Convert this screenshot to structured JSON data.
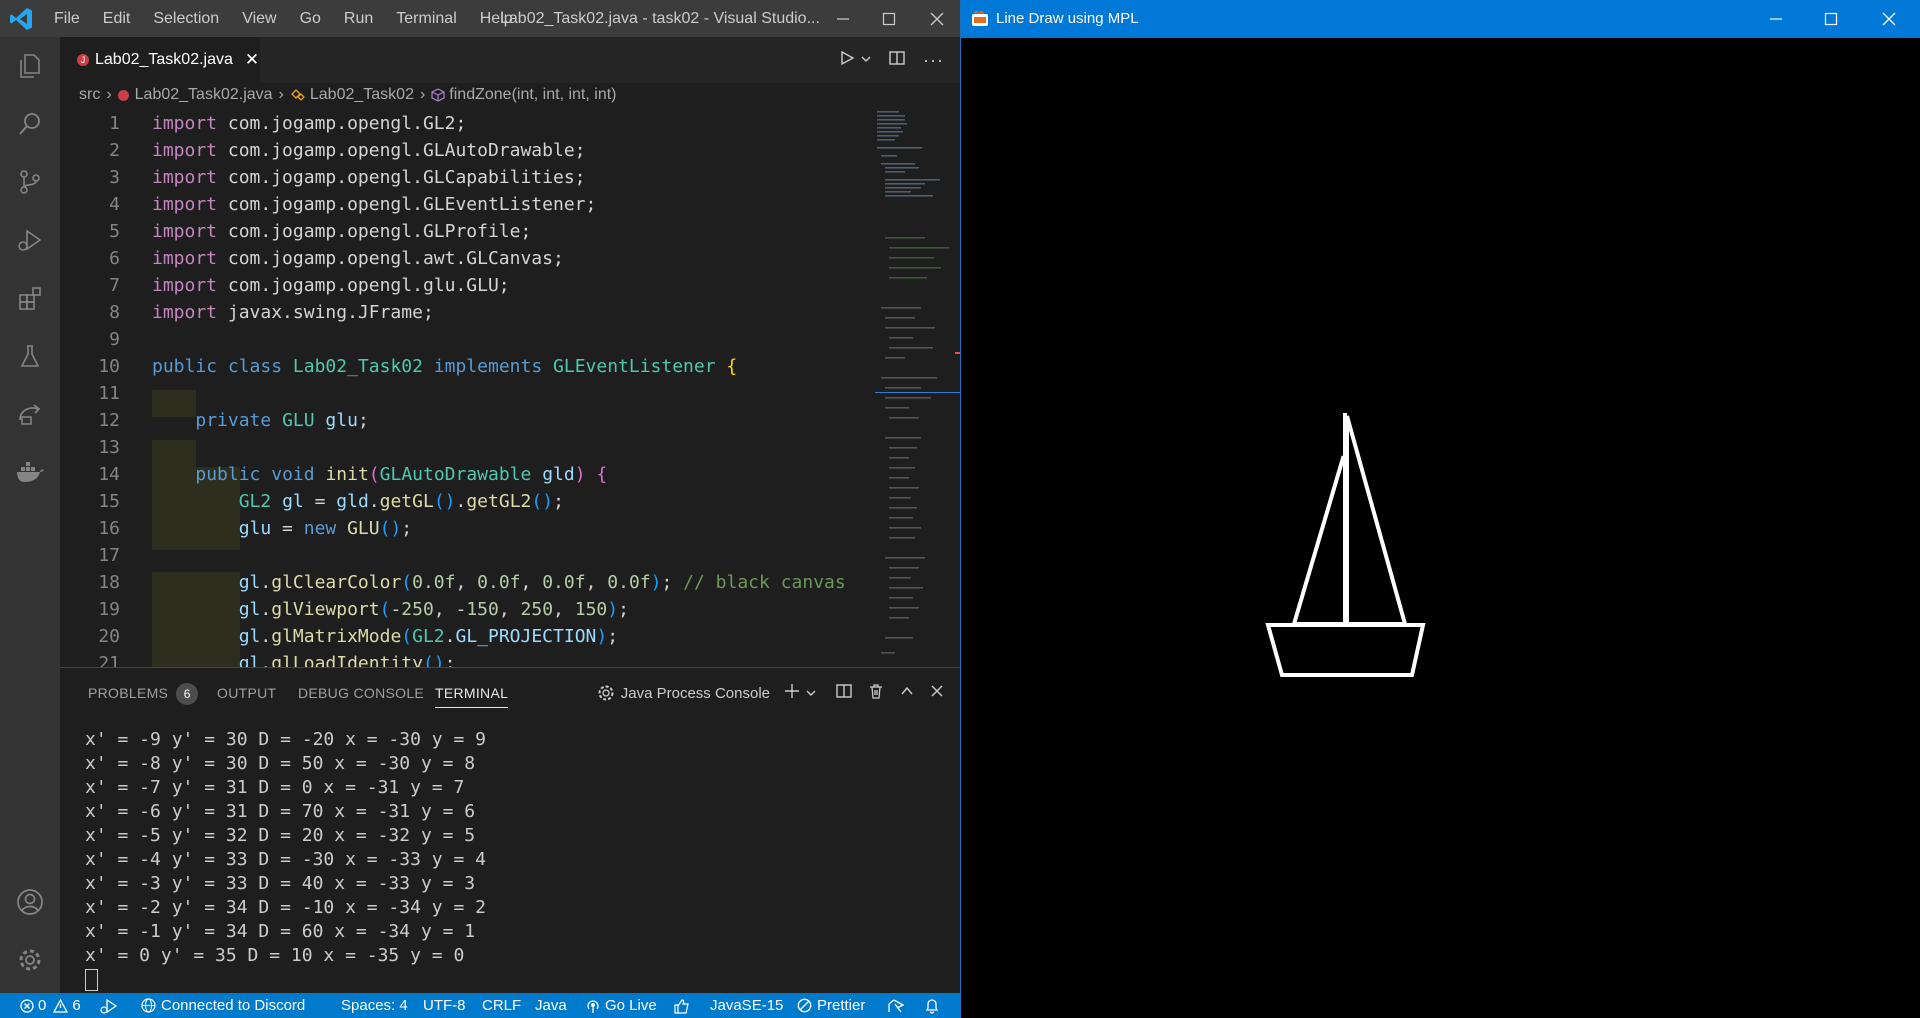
{
  "vscode": {
    "menu": [
      "File",
      "Edit",
      "Selection",
      "View",
      "Go",
      "Run",
      "Terminal",
      "Help"
    ],
    "window_title": "Lab02_Task02.java - task02 - Visual Studio...",
    "tab": {
      "label": "Lab02_Task02.java"
    },
    "breadcrumb": {
      "folder": "src",
      "file": "Lab02_Task02.java",
      "class": "Lab02_Task02",
      "method": "findZone(int, int, int, int)"
    },
    "line_numbers": [
      "1",
      "2",
      "3",
      "4",
      "5",
      "6",
      "7",
      "8",
      "9",
      "10",
      "11",
      "12",
      "13",
      "14",
      "15",
      "16",
      "17",
      "18",
      "19",
      "20",
      "21"
    ],
    "code": {
      "l1": "com.jogamp.opengl.GL2;",
      "l2": "com.jogamp.opengl.GLAutoDrawable;",
      "l3": "com.jogamp.opengl.GLCapabilities;",
      "l4": "com.jogamp.opengl.GLEventListener;",
      "l5": "com.jogamp.opengl.GLProfile;",
      "l6": "com.jogamp.opengl.awt.GLCanvas;",
      "l7": "com.jogamp.opengl.glu.GLU;",
      "l8": "javax.swing.JFrame;",
      "import_kw": "import",
      "class_name": "Lab02_Task02",
      "listener": "GLEventListener",
      "comment": "// black canvas"
    },
    "panel": {
      "tabs": [
        "PROBLEMS",
        "OUTPUT",
        "DEBUG CONSOLE",
        "TERMINAL"
      ],
      "problems_count": "6",
      "console_label": "Java Process Console"
    },
    "terminal_lines": [
      "x' = -9 y' = 30 D = -20 x = -30 y = 9",
      "x' = -8 y' = 30 D = 50 x = -30 y = 8",
      "x' = -7 y' = 31 D = 0 x = -31 y = 7",
      "x' = -6 y' = 31 D = 70 x = -31 y = 6",
      "x' = -5 y' = 32 D = 20 x = -32 y = 5",
      "x' = -4 y' = 33 D = -30 x = -33 y = 4",
      "x' = -3 y' = 33 D = 40 x = -33 y = 3",
      "x' = -2 y' = 34 D = -10 x = -34 y = 2",
      "x' = -1 y' = 34 D = 60 x = -34 y = 1",
      "x' = 0 y' = 35 D = 10 x = -35 y = 0"
    ],
    "status": {
      "errors": "0",
      "warnings": "6",
      "discord": "Connected to Discord",
      "spaces": "Spaces: 4",
      "encoding": "UTF-8",
      "eol": "CRLF",
      "language": "Java",
      "golive": "Go Live",
      "javase": "JavaSE-15",
      "prettier": "Prettier"
    }
  },
  "java_window": {
    "title": "Line Draw using MPL",
    "canvas_background": "#000000",
    "drawing_color": "#ffffff"
  },
  "colors": {
    "accent": "#007acc",
    "java_titlebar": "#0078d7"
  }
}
